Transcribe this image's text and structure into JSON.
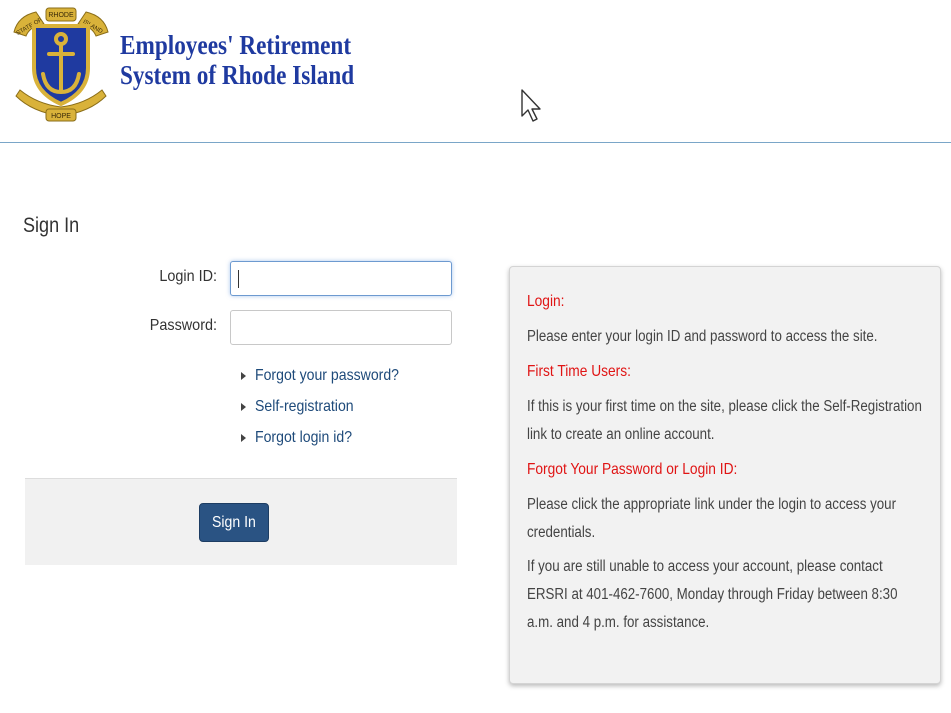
{
  "header": {
    "org_name_line1": "Employees' Retirement",
    "org_name_line2": "System of Rhode Island",
    "seal": {
      "top_text": "RHODE",
      "left_text": "STATE OF",
      "right_text": "ISLAND",
      "bottom_text": "HOPE",
      "icon": "anchor-icon"
    }
  },
  "signin": {
    "heading": "Sign In",
    "login_label": "Login ID:",
    "login_value": "",
    "password_label": "Password:",
    "password_value": "",
    "links": [
      {
        "label": "Forgot your password?"
      },
      {
        "label": "Self-registration"
      },
      {
        "label": "Forgot login id?"
      }
    ],
    "button_label": "Sign In"
  },
  "info": {
    "login_heading": "Login:",
    "login_text": "Please enter your login ID and password to access the site.",
    "first_time_heading": "First Time Users:",
    "first_time_text": "If this is your first time on the site, please click the Self-Registration link to create an online account.",
    "forgot_heading": "Forgot Your Password or Login ID:",
    "forgot_text": "Please click the appropriate link under the login to access your credentials.",
    "contact_text": "If you are still unable to access your account, please contact ERSRI at 401-462-7600, Monday through Friday between 8:30 a.m. and 4 p.m. for assistance."
  },
  "colors": {
    "brand_blue": "#1f3aa0",
    "link": "#1e4a7a",
    "button": "#2a5383",
    "alert_red": "#e01414",
    "seal_gold": "#d9b23a"
  }
}
